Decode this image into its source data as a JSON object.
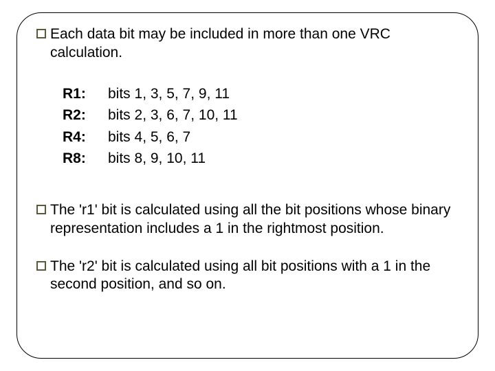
{
  "bullets": {
    "b1": "Each data bit may be included in more than one VRC calculation.",
    "b2": "The 'r1' bit is calculated using all the bit positions whose binary representation includes a 1 in the rightmost position.",
    "b3": "The 'r2' bit is calculated using all bit positions with a 1 in the second position, and so on."
  },
  "rows": [
    {
      "label": "R1:",
      "bits": "bits 1, 3, 5, 7, 9, 11"
    },
    {
      "label": "R2:",
      "bits": "bits 2, 3, 6, 7, 10, 11"
    },
    {
      "label": "R4:",
      "bits": "bits 4, 5, 6, 7"
    },
    {
      "label": "R8:",
      "bits": "bits 8, 9, 10, 11"
    }
  ]
}
